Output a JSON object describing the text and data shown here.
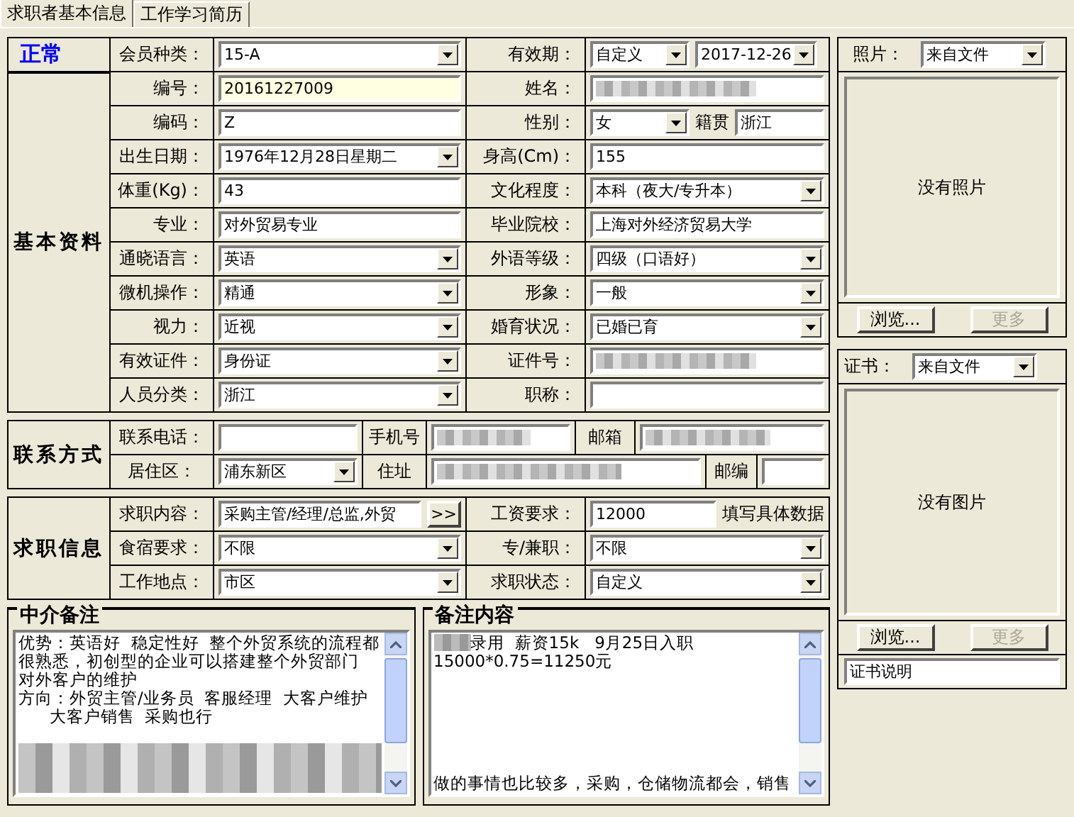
{
  "tabs": [
    {
      "label": "求职者基本信息",
      "selected": true
    },
    {
      "label": "工作学习简历",
      "selected": false
    }
  ],
  "sections": [
    {
      "kind": "basic",
      "status": "正常",
      "heading": "基本资料",
      "rows": [
        [
          {
            "label": "会员种类："
          },
          {
            "controls": [
              {
                "kind": "combo",
                "value": "15-A"
              }
            ]
          },
          {
            "label": "有效期："
          },
          {
            "controls": [
              {
                "kind": "combo",
                "value": "自定义"
              },
              {
                "kind": "combo",
                "value": "2017-12-26"
              }
            ]
          }
        ],
        [
          {
            "label": "编号："
          },
          {
            "controls": [
              {
                "kind": "readonly",
                "value": "20161227009"
              }
            ]
          },
          {
            "label": "姓名："
          },
          {
            "controls": [
              {
                "kind": "redacted"
              }
            ]
          }
        ],
        [
          {
            "label": "编码："
          },
          {
            "controls": [
              {
                "kind": "text",
                "value": "Z"
              }
            ]
          },
          {
            "label": "性别："
          },
          {
            "controls": [
              {
                "kind": "combo",
                "value": "女"
              },
              {
                "kind": "note",
                "value": "籍贯"
              },
              {
                "kind": "text",
                "value": "浙江"
              }
            ]
          }
        ],
        [
          {
            "label": "出生日期："
          },
          {
            "controls": [
              {
                "kind": "combo",
                "value": "1976年12月28日星期二"
              }
            ]
          },
          {
            "label": "身高(Cm)："
          },
          {
            "controls": [
              {
                "kind": "text",
                "value": "155"
              }
            ]
          }
        ],
        [
          {
            "label": "体重(Kg)："
          },
          {
            "controls": [
              {
                "kind": "text",
                "value": "43"
              }
            ]
          },
          {
            "label": "文化程度："
          },
          {
            "controls": [
              {
                "kind": "combo",
                "value": "本科（夜大/专升本）"
              }
            ]
          }
        ],
        [
          {
            "label": "专业："
          },
          {
            "controls": [
              {
                "kind": "text",
                "value": "对外贸易专业"
              }
            ]
          },
          {
            "label": "毕业院校："
          },
          {
            "controls": [
              {
                "kind": "text",
                "value": "上海对外经济贸易大学"
              }
            ]
          }
        ],
        [
          {
            "label": "通晓语言："
          },
          {
            "controls": [
              {
                "kind": "combo",
                "value": "英语"
              }
            ]
          },
          {
            "label": "外语等级："
          },
          {
            "controls": [
              {
                "kind": "combo",
                "value": "四级（口语好）"
              }
            ]
          }
        ],
        [
          {
            "label": "微机操作："
          },
          {
            "controls": [
              {
                "kind": "combo",
                "value": "精通"
              }
            ]
          },
          {
            "label": "形象："
          },
          {
            "controls": [
              {
                "kind": "combo",
                "value": "一般"
              }
            ]
          }
        ],
        [
          {
            "label": "视力："
          },
          {
            "controls": [
              {
                "kind": "combo",
                "value": "近视"
              }
            ]
          },
          {
            "label": "婚育状况："
          },
          {
            "controls": [
              {
                "kind": "combo",
                "value": "已婚已育"
              }
            ]
          }
        ],
        [
          {
            "label": "有效证件："
          },
          {
            "controls": [
              {
                "kind": "combo",
                "value": "身份证"
              }
            ]
          },
          {
            "label": "证件号："
          },
          {
            "controls": [
              {
                "kind": "redacted"
              }
            ]
          }
        ],
        [
          {
            "label": "人员分类："
          },
          {
            "controls": [
              {
                "kind": "combo",
                "value": "浙江"
              }
            ]
          },
          {
            "label": "职称："
          },
          {
            "controls": [
              {
                "kind": "text"
              }
            ]
          }
        ]
      ]
    },
    {
      "kind": "contact",
      "heading": "联系方式",
      "rows": [
        [
          {
            "label": "联系电话："
          },
          {
            "controls": [
              {
                "kind": "text"
              }
            ]
          },
          {
            "label": "手机号"
          },
          {
            "controls": [
              {
                "kind": "redacted"
              }
            ]
          },
          {
            "label": "邮箱"
          },
          {
            "controls": [
              {
                "kind": "redacted"
              }
            ]
          }
        ],
        [
          {
            "label": "居住区："
          },
          {
            "controls": [
              {
                "kind": "combo",
                "value": "浦东新区"
              }
            ]
          },
          {
            "label": "住址"
          },
          {
            "controls": [
              {
                "kind": "redacted"
              }
            ]
          },
          {
            "label": "邮编"
          },
          {
            "controls": [
              {
                "kind": "text"
              }
            ]
          }
        ]
      ]
    },
    {
      "kind": "job",
      "heading": "求职信息",
      "rows": [
        [
          {
            "label": "求职内容："
          },
          {
            "controls": [
              {
                "kind": "text",
                "value": "采购主管/经理/总监,外贸"
              },
              {
                "kind": "button",
                "value": ">>"
              }
            ]
          },
          {
            "label": "工资要求："
          },
          {
            "controls": [
              {
                "kind": "text",
                "value": "12000"
              },
              {
                "kind": "note",
                "value": "填写具体数据"
              }
            ]
          }
        ],
        [
          {
            "label": "食宿要求："
          },
          {
            "controls": [
              {
                "kind": "combo",
                "value": "不限"
              }
            ]
          },
          {
            "label": "专/兼职："
          },
          {
            "controls": [
              {
                "kind": "combo",
                "value": "不限"
              }
            ]
          }
        ],
        [
          {
            "label": "工作地点："
          },
          {
            "controls": [
              {
                "kind": "combo",
                "value": "市区"
              }
            ]
          },
          {
            "label": "求职状态："
          },
          {
            "controls": [
              {
                "kind": "combo",
                "value": "自定义"
              }
            ]
          }
        ]
      ]
    }
  ],
  "notes": [
    {
      "title": "中介备注",
      "lines": [
        {
          "kind": "text",
          "text": "优势：英语好  稳定性好  整个外贸系统的流程都"
        },
        {
          "kind": "text",
          "text": "很熟悉，初创型的企业可以搭建整个外贸部门"
        },
        {
          "kind": "text",
          "text": "对外客户的维护"
        },
        {
          "kind": "text",
          "text": "方向：外贸主管/业务员  客服经理  大客户维护"
        },
        {
          "kind": "text",
          "text": "      大客户销售  采购也行"
        },
        {
          "kind": "redacted"
        }
      ]
    },
    {
      "title": "备注内容",
      "lines": [
        {
          "kind": "text",
          "text": "录用  薪资15k   9月25日入职",
          "redacted_prefix": true
        },
        {
          "kind": "text",
          "text": "15000*0.75=11250元"
        },
        {
          "kind": "gap"
        },
        {
          "kind": "text",
          "text": "做的事情也比较多，采购，仓储物流都会，销售"
        }
      ]
    }
  ],
  "media_panels": [
    {
      "label": "照片：",
      "source": "来自文件",
      "empty_text": "没有照片",
      "buttons": [
        {
          "label": "浏览...",
          "disabled": false
        },
        {
          "label": "更多",
          "disabled": true
        }
      ]
    },
    {
      "label": "证书：",
      "source": "来自文件",
      "empty_text": "没有图片",
      "buttons": [
        {
          "label": "浏览...",
          "disabled": false
        },
        {
          "label": "更多",
          "disabled": true
        }
      ],
      "caption": "证书说明"
    }
  ]
}
